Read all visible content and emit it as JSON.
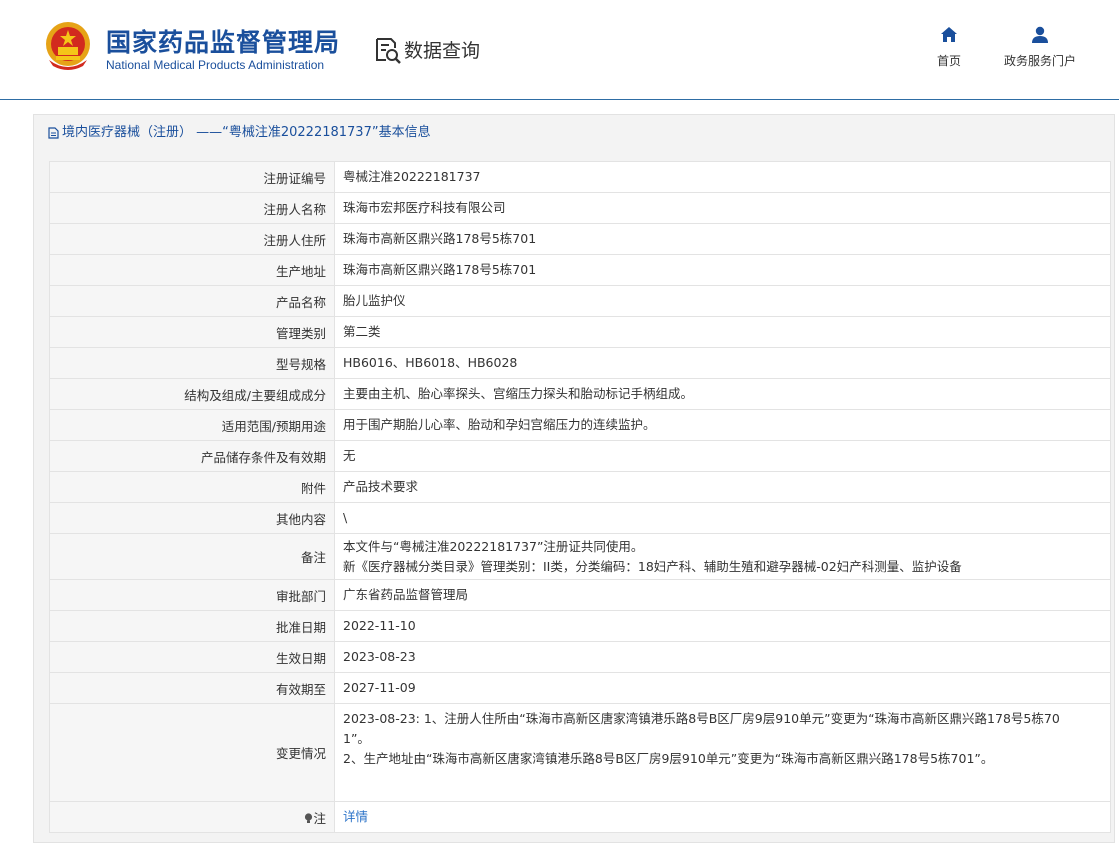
{
  "header": {
    "brand_cn": "国家药品监督管理局",
    "brand_en": "National Medical Products Administration",
    "query_label": "数据查询",
    "nav": [
      {
        "label": "首页",
        "icon": "home-icon"
      },
      {
        "label": "政务服务门户",
        "icon": "user-icon"
      }
    ]
  },
  "colors": {
    "brand": "#1a4f9c",
    "link": "#2b73c8",
    "panel_bg": "#f3f3f3",
    "label_bg": "#f6f6f6"
  },
  "panel": {
    "title": "境内医疗器械（注册） ——“粤械注准20222181737”基本信息",
    "icon": "document-icon"
  },
  "rows": [
    {
      "label": "注册证编号",
      "value": "粤械注准20222181737"
    },
    {
      "label": "注册人名称",
      "value": "珠海市宏邦医疗科技有限公司"
    },
    {
      "label": "注册人住所",
      "value": "珠海市高新区鼎兴路178号5栋701"
    },
    {
      "label": "生产地址",
      "value": "珠海市高新区鼎兴路178号5栋701"
    },
    {
      "label": "产品名称",
      "value": "胎儿监护仪"
    },
    {
      "label": "管理类别",
      "value": "第二类"
    },
    {
      "label": "型号规格",
      "value": "HB6016、HB6018、HB6028"
    },
    {
      "label": "结构及组成/主要组成成分",
      "value": "主要由主机、胎心率探头、宫缩压力探头和胎动标记手柄组成。"
    },
    {
      "label": "适用范围/预期用途",
      "value": "用于围产期胎儿心率、胎动和孕妇宫缩压力的连续监护。"
    },
    {
      "label": "产品储存条件及有效期",
      "value": "无"
    },
    {
      "label": "附件",
      "value": "产品技术要求"
    },
    {
      "label": "其他内容",
      "value": "\\"
    }
  ],
  "note": {
    "label": "备注",
    "line1": "本文件与“粤械注准20222181737”注册证共同使用。",
    "line2": "新《医疗器械分类目录》管理类别：II类，分类编码：18妇产科、辅助生殖和避孕器械-02妇产科测量、监护设备"
  },
  "rows2": [
    {
      "label": "审批部门",
      "value": "广东省药品监督管理局"
    },
    {
      "label": "批准日期",
      "value": "2022-11-10"
    },
    {
      "label": "生效日期",
      "value": "2023-08-23"
    },
    {
      "label": "有效期至",
      "value": "2027-11-09"
    }
  ],
  "change": {
    "label": "变更情况",
    "line1": "2023-08-23: 1、注册人住所由“珠海市高新区唐家湾镇港乐路8号B区厂房9层910单元”变更为“珠海市高新区鼎兴路178号5栋70",
    "line2": "1”。",
    "line3": "2、生产地址由“珠海市高新区唐家湾镇港乐路8号B区厂房9层910单元”变更为“珠海市高新区鼎兴路178号5栋701”。"
  },
  "tip": {
    "label": "注",
    "icon": "bulb-icon",
    "link": "详情"
  }
}
